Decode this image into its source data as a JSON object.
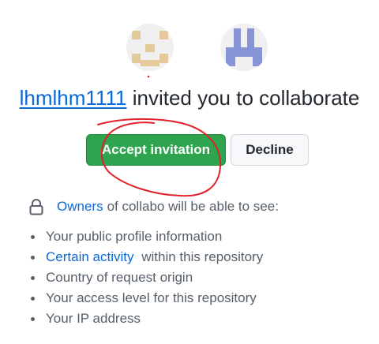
{
  "avatars": {
    "inviter": {
      "icon": "identicon-tan",
      "color": "#e4c99b"
    },
    "invitee": {
      "icon": "identicon-blue",
      "color": "#8795d8"
    }
  },
  "headline": {
    "username": "lhmlhm1111",
    "text": "invited you to collaborate"
  },
  "actions": {
    "accept_label": "Accept invitation",
    "decline_label": "Decline"
  },
  "notice": {
    "icon": "lock-icon",
    "owners_link": "Owners",
    "text": "of collabo will be able to see:"
  },
  "permissions": [
    {
      "text": "Your public profile information"
    },
    {
      "link": "Certain activity",
      "text": "within this repository"
    },
    {
      "text": "Country of request origin"
    },
    {
      "text": "Your access level for this repository"
    },
    {
      "text": "Your IP address"
    }
  ],
  "colors": {
    "link": "#0969da",
    "accept": "#2ea44f",
    "annotation": "#e0202a"
  }
}
